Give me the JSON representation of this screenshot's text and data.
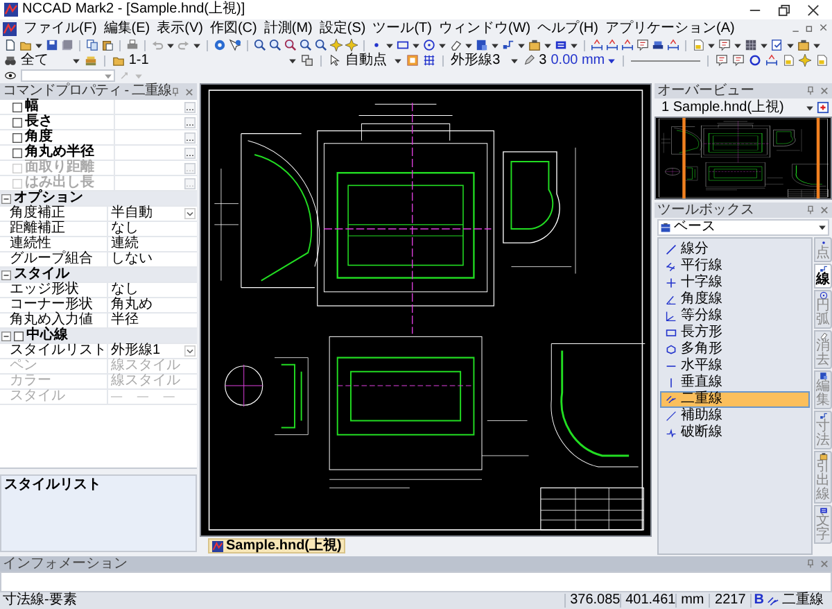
{
  "window": {
    "title": "NCCAD Mark2 - [Sample.hnd(上視)]"
  },
  "menu": [
    "ファイル(F)",
    "編集(E)",
    "表示(V)",
    "作図(C)",
    "計測(M)",
    "設定(S)",
    "ツール(T)",
    "ウィンドウ(W)",
    "ヘルプ(H)",
    "アプリケーション(A)"
  ],
  "toolbar": {
    "filter": "全て",
    "layer": "1-1",
    "snap": "自動点",
    "line_style": "外形線3",
    "pen_number": "3",
    "line_width": "0.00 mm"
  },
  "property_panel": {
    "title": "コマンドプロパティ - 二重線",
    "rows": [
      {
        "kind": "check",
        "label": "幅",
        "checked": false,
        "disabled": false
      },
      {
        "kind": "check",
        "label": "長さ",
        "checked": false,
        "disabled": false
      },
      {
        "kind": "check",
        "label": "角度",
        "checked": false,
        "disabled": false
      },
      {
        "kind": "check",
        "label": "角丸め半径",
        "checked": false,
        "disabled": false
      },
      {
        "kind": "check",
        "label": "面取り距離",
        "checked": false,
        "disabled": true
      },
      {
        "kind": "check",
        "label": "はみ出し長",
        "checked": false,
        "disabled": true
      },
      {
        "kind": "section",
        "label": "オプション",
        "expanded": true
      },
      {
        "kind": "value",
        "label": "角度補正",
        "value": "半自動",
        "dropdown": true,
        "disabled": false
      },
      {
        "kind": "value",
        "label": "距離補正",
        "value": "なし",
        "disabled": false
      },
      {
        "kind": "value",
        "label": "連続性",
        "value": "連続",
        "disabled": false
      },
      {
        "kind": "value",
        "label": "グループ組合",
        "value": "しない",
        "disabled": false
      },
      {
        "kind": "section",
        "label": "スタイル",
        "expanded": true
      },
      {
        "kind": "value",
        "label": "エッジ形状",
        "value": "なし",
        "disabled": false
      },
      {
        "kind": "value",
        "label": "コーナー形状",
        "value": "角丸め",
        "disabled": false
      },
      {
        "kind": "value",
        "label": "角丸め入力値",
        "value": "半径",
        "disabled": false
      },
      {
        "kind": "section",
        "label": "中心線",
        "expanded": true,
        "checked": false
      },
      {
        "kind": "value",
        "label": "スタイルリスト",
        "value": "外形線1",
        "dropdown": true,
        "disabled": false
      },
      {
        "kind": "value",
        "label": "ペン",
        "value": "線スタイル",
        "disabled": true
      },
      {
        "kind": "value",
        "label": "カラー",
        "value": "線スタイル",
        "disabled": true
      },
      {
        "kind": "dash",
        "label": "スタイル",
        "disabled": true
      }
    ]
  },
  "description": {
    "title": "スタイルリスト"
  },
  "document_tab": {
    "label": "Sample.hnd(上視)"
  },
  "overview": {
    "title": "オーバービュー",
    "document": "1 Sample.hnd(上視)"
  },
  "toolbox": {
    "title": "ツールボックス",
    "category": "ベース",
    "tools": [
      {
        "label": "線分",
        "selected": false
      },
      {
        "label": "平行線",
        "selected": false
      },
      {
        "label": "十字線",
        "selected": false
      },
      {
        "label": "角度線",
        "selected": false
      },
      {
        "label": "等分線",
        "selected": false
      },
      {
        "label": "長方形",
        "selected": false
      },
      {
        "label": "多角形",
        "selected": false
      },
      {
        "label": "水平線",
        "selected": false
      },
      {
        "label": "垂直線",
        "selected": false
      },
      {
        "label": "二重線",
        "selected": true
      },
      {
        "label": "補助線",
        "selected": false
      },
      {
        "label": "破断線",
        "selected": false
      }
    ],
    "tabs": [
      {
        "label": "点",
        "selected": false
      },
      {
        "label": "線",
        "selected": true
      },
      {
        "label": "円弧",
        "selected": false
      },
      {
        "label": "消去",
        "selected": false
      },
      {
        "label": "編集",
        "selected": false
      },
      {
        "label": "寸法",
        "selected": false
      },
      {
        "label": "引出線",
        "selected": false
      },
      {
        "label": "文字",
        "selected": false
      }
    ]
  },
  "info_panel": {
    "title": "インフォメーション"
  },
  "status_bar": {
    "message": "寸法線-要素",
    "coordinate_1": "376.085",
    "coordinate_2": "401.461",
    "unit": "mm",
    "count": "2217",
    "layer_mark": "B",
    "mode": "二重線"
  }
}
